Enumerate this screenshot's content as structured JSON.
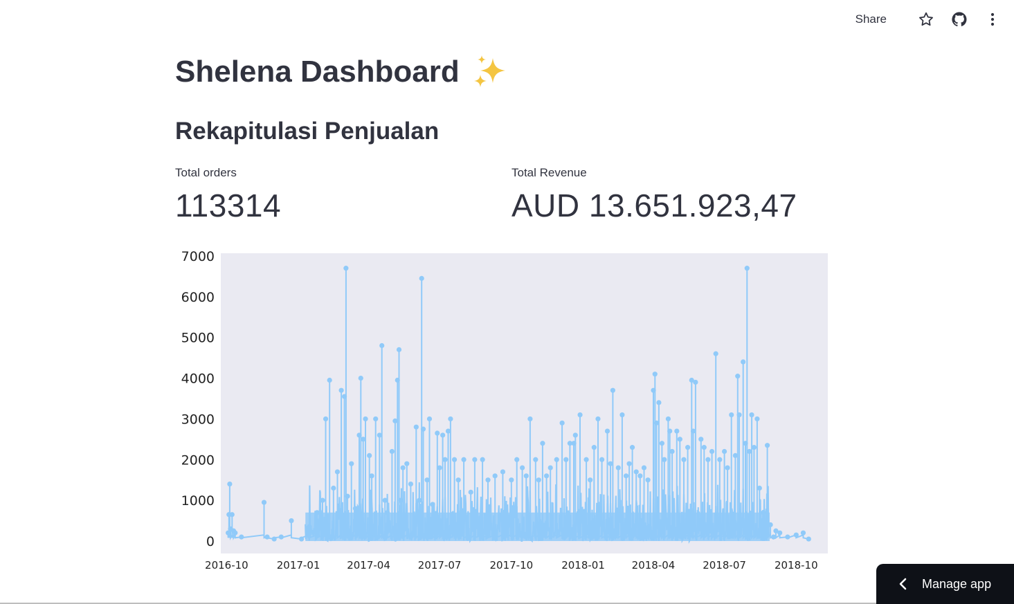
{
  "toolbar": {
    "share_label": "Share",
    "icons": [
      "star-icon",
      "github-icon",
      "more-vertical-icon"
    ]
  },
  "page": {
    "title": "Shelena Dashboard",
    "title_emoji": "✨",
    "section_title": "Rekapitulasi Penjualan"
  },
  "metrics": {
    "orders_label": "Total orders",
    "orders_value": "113314",
    "revenue_label": "Total Revenue",
    "revenue_value": "AUD 13.651.923,47"
  },
  "manage_app": {
    "label": "Manage app"
  },
  "colors": {
    "line": "#90caf9",
    "plot_bg": "#eaeaf2",
    "manage_bg": "#0e1117",
    "sparkle": "#f4c542"
  },
  "chart_data": {
    "type": "line",
    "title": "",
    "xlabel": "",
    "ylabel": "",
    "ylim": [
      0,
      7000
    ],
    "yticks": [
      "0",
      "1000",
      "2000",
      "3000",
      "4000",
      "5000",
      "6000",
      "7000"
    ],
    "xticks": [
      "2016-10",
      "2017-01",
      "2017-04",
      "2017-07",
      "2017-10",
      "2018-01",
      "2018-04",
      "2018-07",
      "2018-10"
    ],
    "x_range": [
      "2016-09-28",
      "2018-10-30"
    ],
    "grid": false,
    "legend": "none",
    "series": [
      {
        "marker": "circle",
        "points": [
          [
            "2016-10-03",
            200
          ],
          [
            "2016-10-04",
            650
          ],
          [
            "2016-10-05",
            1400
          ],
          [
            "2016-10-06",
            300
          ],
          [
            "2016-10-08",
            650
          ],
          [
            "2016-10-10",
            250
          ],
          [
            "2016-10-12",
            200
          ],
          [
            "2016-10-20",
            100
          ],
          [
            "2016-11-18",
            950
          ],
          [
            "2016-11-22",
            100
          ],
          [
            "2016-12-01",
            50
          ],
          [
            "2016-12-10",
            100
          ],
          [
            "2016-12-23",
            500
          ],
          [
            "2017-01-05",
            50
          ],
          [
            "2017-01-15",
            350
          ],
          [
            "2017-01-25",
            700
          ],
          [
            "2017-02-01",
            1000
          ],
          [
            "2017-02-05",
            3000
          ],
          [
            "2017-02-10",
            3950
          ],
          [
            "2017-02-15",
            1300
          ],
          [
            "2017-02-20",
            1700
          ],
          [
            "2017-02-25",
            3700
          ],
          [
            "2017-03-01",
            3550
          ],
          [
            "2017-03-03",
            6700
          ],
          [
            "2017-03-05",
            1100
          ],
          [
            "2017-03-10",
            1900
          ],
          [
            "2017-03-15",
            800
          ],
          [
            "2017-03-20",
            2600
          ],
          [
            "2017-03-22",
            4000
          ],
          [
            "2017-03-25",
            2500
          ],
          [
            "2017-03-28",
            3000
          ],
          [
            "2017-04-02",
            2100
          ],
          [
            "2017-04-05",
            1600
          ],
          [
            "2017-04-10",
            3000
          ],
          [
            "2017-04-15",
            2600
          ],
          [
            "2017-04-18",
            4800
          ],
          [
            "2017-04-22",
            1000
          ],
          [
            "2017-04-25",
            700
          ],
          [
            "2017-05-01",
            2200
          ],
          [
            "2017-05-05",
            2950
          ],
          [
            "2017-05-08",
            3950
          ],
          [
            "2017-05-10",
            4700
          ],
          [
            "2017-05-12",
            1000
          ],
          [
            "2017-05-15",
            1800
          ],
          [
            "2017-05-20",
            1900
          ],
          [
            "2017-05-25",
            1400
          ],
          [
            "2017-06-01",
            2800
          ],
          [
            "2017-06-05",
            1000
          ],
          [
            "2017-06-08",
            6450
          ],
          [
            "2017-06-10",
            2750
          ],
          [
            "2017-06-15",
            1500
          ],
          [
            "2017-06-18",
            3000
          ],
          [
            "2017-06-22",
            900
          ],
          [
            "2017-06-28",
            2650
          ],
          [
            "2017-07-01",
            1800
          ],
          [
            "2017-07-05",
            2600
          ],
          [
            "2017-07-08",
            2000
          ],
          [
            "2017-07-12",
            2700
          ],
          [
            "2017-07-15",
            3000
          ],
          [
            "2017-07-20",
            2000
          ],
          [
            "2017-07-25",
            1500
          ],
          [
            "2017-08-01",
            2000
          ],
          [
            "2017-08-10",
            1200
          ],
          [
            "2017-08-15",
            2000
          ],
          [
            "2017-08-25",
            2000
          ],
          [
            "2017-09-01",
            1500
          ],
          [
            "2017-09-10",
            1600
          ],
          [
            "2017-09-20",
            1700
          ],
          [
            "2017-10-01",
            1500
          ],
          [
            "2017-10-08",
            2000
          ],
          [
            "2017-10-15",
            1800
          ],
          [
            "2017-10-20",
            1600
          ],
          [
            "2017-10-25",
            3000
          ],
          [
            "2017-11-01",
            2000
          ],
          [
            "2017-11-05",
            1500
          ],
          [
            "2017-11-10",
            2400
          ],
          [
            "2017-11-15",
            1600
          ],
          [
            "2017-11-20",
            1800
          ],
          [
            "2017-11-28",
            2000
          ],
          [
            "2017-12-05",
            2900
          ],
          [
            "2017-12-10",
            2000
          ],
          [
            "2017-12-15",
            2400
          ],
          [
            "2017-12-20",
            2400
          ],
          [
            "2017-12-22",
            2600
          ],
          [
            "2017-12-28",
            3100
          ],
          [
            "2018-01-05",
            2000
          ],
          [
            "2018-01-10",
            1500
          ],
          [
            "2018-01-15",
            2300
          ],
          [
            "2018-01-20",
            3000
          ],
          [
            "2018-01-25",
            2000
          ],
          [
            "2018-02-01",
            2700
          ],
          [
            "2018-02-05",
            1900
          ],
          [
            "2018-02-08",
            3700
          ],
          [
            "2018-02-15",
            1800
          ],
          [
            "2018-02-20",
            3100
          ],
          [
            "2018-02-25",
            1600
          ],
          [
            "2018-03-01",
            1900
          ],
          [
            "2018-03-05",
            2300
          ],
          [
            "2018-03-10",
            1700
          ],
          [
            "2018-03-15",
            1600
          ],
          [
            "2018-03-20",
            1800
          ],
          [
            "2018-03-25",
            1500
          ],
          [
            "2018-04-01",
            3700
          ],
          [
            "2018-04-03",
            4100
          ],
          [
            "2018-04-05",
            2900
          ],
          [
            "2018-04-08",
            3400
          ],
          [
            "2018-04-12",
            2400
          ],
          [
            "2018-04-15",
            2000
          ],
          [
            "2018-04-20",
            3000
          ],
          [
            "2018-04-22",
            2700
          ],
          [
            "2018-04-25",
            2200
          ],
          [
            "2018-05-01",
            2700
          ],
          [
            "2018-05-05",
            2500
          ],
          [
            "2018-05-10",
            2000
          ],
          [
            "2018-05-15",
            2300
          ],
          [
            "2018-05-20",
            3950
          ],
          [
            "2018-05-22",
            2700
          ],
          [
            "2018-05-25",
            3900
          ],
          [
            "2018-06-01",
            2500
          ],
          [
            "2018-06-05",
            2300
          ],
          [
            "2018-06-10",
            2000
          ],
          [
            "2018-06-15",
            2200
          ],
          [
            "2018-06-20",
            4600
          ],
          [
            "2018-06-25",
            2000
          ],
          [
            "2018-07-01",
            2200
          ],
          [
            "2018-07-05",
            1800
          ],
          [
            "2018-07-10",
            3100
          ],
          [
            "2018-07-15",
            2100
          ],
          [
            "2018-07-18",
            4050
          ],
          [
            "2018-07-20",
            3100
          ],
          [
            "2018-07-25",
            4400
          ],
          [
            "2018-07-28",
            2400
          ],
          [
            "2018-07-30",
            6700
          ],
          [
            "2018-08-02",
            2200
          ],
          [
            "2018-08-05",
            3100
          ],
          [
            "2018-08-08",
            2300
          ],
          [
            "2018-08-12",
            3000
          ],
          [
            "2018-08-15",
            1300
          ],
          [
            "2018-08-20",
            700
          ],
          [
            "2018-08-25",
            2350
          ],
          [
            "2018-08-29",
            400
          ],
          [
            "2018-09-02",
            100
          ],
          [
            "2018-09-05",
            250
          ],
          [
            "2018-09-10",
            200
          ],
          [
            "2018-09-20",
            100
          ],
          [
            "2018-10-01",
            150
          ],
          [
            "2018-10-10",
            200
          ],
          [
            "2018-10-17",
            50
          ]
        ]
      }
    ]
  }
}
